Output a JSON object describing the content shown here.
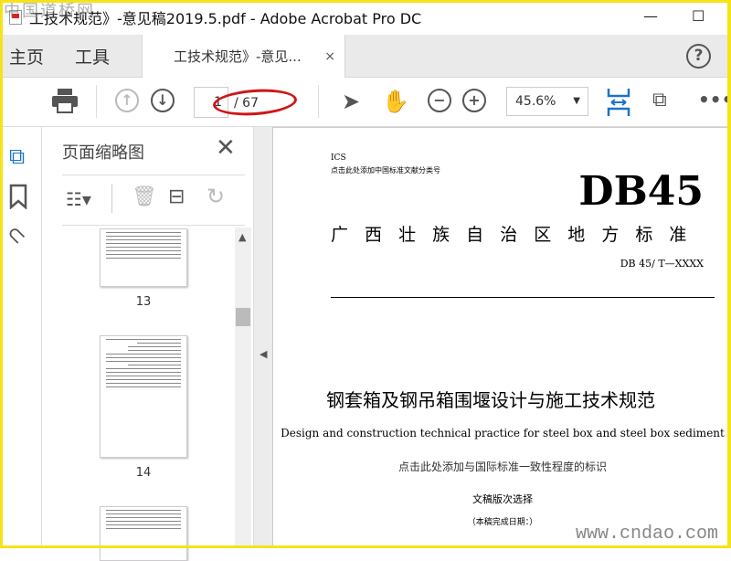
{
  "window": {
    "title": "工技术规范》-意见稿2019.5.pdf - Adobe Acrobat Pro DC",
    "minimize": "—",
    "maximize": "☐"
  },
  "tabs": {
    "home": "主页",
    "tools": "工具",
    "doc_tab": "工技术规范》-意见...",
    "close": "×",
    "help": "?"
  },
  "toolbar": {
    "page_current": "1",
    "page_total": "/ 67",
    "zoom": "45.6%"
  },
  "panel": {
    "title": "页面缩略图",
    "close": "✕",
    "thumbnails": [
      {
        "label": "13"
      },
      {
        "label": "14"
      }
    ]
  },
  "document": {
    "ics": "ICS",
    "classification": "点击此处添加中国标准文献分类号",
    "code": "DB45",
    "authority": "广 西 壮 族 自 治 区 地 方 标 准",
    "number": "DB 45/  T—XXXX",
    "title_cn": "钢套箱及钢吊箱围堰设计与施工技术规范",
    "title_en": "Design and construction technical practice for steel box and steel box sediment",
    "consistency": "点击此处添加与国际标准一致性程度的标识",
    "draft": "文稿版次选择",
    "date": "（本稿完成日期：）"
  },
  "watermarks": {
    "top": "中国道桥网",
    "bottom": "www.cndao.com"
  },
  "colors": {
    "accent": "#1a73c8",
    "annotation": "#d01515",
    "border": "#f5e31a"
  }
}
